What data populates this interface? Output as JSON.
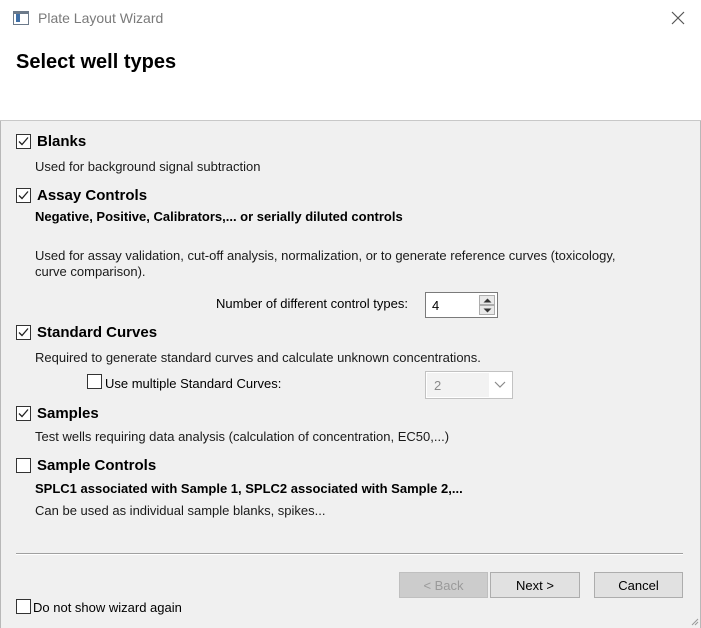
{
  "window": {
    "title": "Plate Layout Wizard"
  },
  "header": {
    "title": "Select well types"
  },
  "sections": {
    "blanks": {
      "label": "Blanks",
      "checked": true,
      "description": "Used for background signal subtraction"
    },
    "assay_controls": {
      "label": "Assay Controls",
      "checked": true,
      "subtitle": "Negative, Positive, Calibrators,... or serially diluted controls",
      "description_line1": "Used for assay validation, cut-off analysis, normalization, or to generate reference curves (toxicology,",
      "description_line2": "curve comparison).",
      "control_types_label": "Number of different control types:",
      "control_types_value": "4"
    },
    "standard_curves": {
      "label": "Standard Curves",
      "checked": true,
      "description": "Required to generate standard curves and calculate unknown concentrations.",
      "multiple_label": "Use multiple Standard Curves:",
      "multiple_checked": false,
      "multiple_value": "2"
    },
    "samples": {
      "label": "Samples",
      "checked": true,
      "description": "Test wells requiring data analysis (calculation of concentration, EC50,...)"
    },
    "sample_controls": {
      "label": "Sample Controls",
      "checked": false,
      "subtitle": "SPLC1 associated with Sample 1, SPLC2 associated with Sample 2,...",
      "description": "Can be used as individual sample blanks, spikes..."
    }
  },
  "footer": {
    "back_label": "< Back",
    "next_label": "Next >",
    "cancel_label": "Cancel",
    "dont_show_label": "Do not show wizard again",
    "dont_show_checked": false
  },
  "icons": {
    "app": "app-window-icon",
    "close": "close-icon",
    "check": "checkmark-icon",
    "spin_up": "arrow-up-icon",
    "spin_down": "arrow-down-icon",
    "dropdown": "chevron-down-icon"
  }
}
